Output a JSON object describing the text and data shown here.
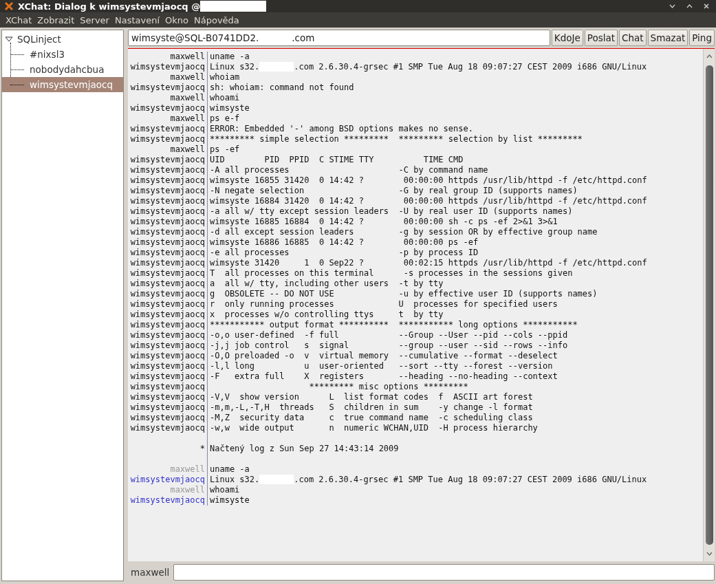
{
  "window": {
    "title": "XChat: Dialog k wimsystevmjaocq @",
    "title_redacted": true
  },
  "menu": [
    "XChat",
    "Zobrazit",
    "Server",
    "Nastavení",
    "Okno",
    "Nápověda"
  ],
  "tree": {
    "label": "SQLinject",
    "expanded": true,
    "children": [
      {
        "label": "#nixsl3",
        "selected": false
      },
      {
        "label": "nobodydahcbua",
        "selected": false
      },
      {
        "label": "wimsystevmjaocq",
        "selected": true
      }
    ]
  },
  "topic_parts": [
    "wimsyste@SQL-B0741DD2.",
    ".com"
  ],
  "buttons": [
    "KdoJe",
    "Poslat",
    "Chat",
    "Smazat",
    "Ping"
  ],
  "log": [
    {
      "kind": "old",
      "nick": "maxwell",
      "text": [
        "uname -a"
      ]
    },
    {
      "kind": "old",
      "nick": "wimsystevmjaocq",
      "text": [
        "Linux s32.",
        ".com 2.6.30.4-grsec #1 SMP Tue Aug 18 09:07:27 CEST 2009 i686 GNU/Linux"
      ]
    },
    {
      "kind": "old",
      "nick": "maxwell",
      "text": [
        "whoiam"
      ]
    },
    {
      "kind": "old",
      "nick": "wimsystevmjaocq",
      "text": [
        "sh: whoiam: command not found"
      ]
    },
    {
      "kind": "old",
      "nick": "maxwell",
      "text": [
        "whoami"
      ]
    },
    {
      "kind": "old",
      "nick": "wimsystevmjaocq",
      "text": [
        "wimsyste"
      ]
    },
    {
      "kind": "old",
      "nick": "maxwell",
      "text": [
        "ps e-f"
      ]
    },
    {
      "kind": "old",
      "nick": "wimsystevmjaocq",
      "text": [
        "ERROR: Embedded '-' among BSD options makes no sense."
      ]
    },
    {
      "kind": "old",
      "nick": "wimsystevmjaocq",
      "text": [
        "********* simple selection *********  ********* selection by list *********"
      ]
    },
    {
      "kind": "old",
      "nick": "maxwell",
      "text": [
        "ps -ef"
      ]
    },
    {
      "kind": "old",
      "nick": "wimsystevmjaocq",
      "text": [
        "UID        PID  PPID  C STIME TTY          TIME CMD"
      ]
    },
    {
      "kind": "old",
      "nick": "wimsystevmjaocq",
      "text": [
        "-A all processes                      -C by command name"
      ]
    },
    {
      "kind": "old",
      "nick": "wimsystevmjaocq",
      "text": [
        "wimsyste 16855 31420  0 14:42 ?        00:00:00 httpds /usr/lib/httpd -f /etc/httpd.conf"
      ]
    },
    {
      "kind": "old",
      "nick": "wimsystevmjaocq",
      "text": [
        "-N negate selection                   -G by real group ID (supports names)"
      ]
    },
    {
      "kind": "old",
      "nick": "wimsystevmjaocq",
      "text": [
        "wimsyste 16884 31420  0 14:42 ?        00:00:00 httpds /usr/lib/httpd -f /etc/httpd.conf"
      ]
    },
    {
      "kind": "old",
      "nick": "wimsystevmjaocq",
      "text": [
        "-a all w/ tty except session leaders  -U by real user ID (supports names)"
      ]
    },
    {
      "kind": "old",
      "nick": "wimsystevmjaocq",
      "text": [
        "wimsyste 16885 16884  0 14:42 ?        00:00:00 sh -c ps -ef 2>&1 3>&1"
      ]
    },
    {
      "kind": "old",
      "nick": "wimsystevmjaocq",
      "text": [
        "-d all except session leaders         -g by session OR by effective group name"
      ]
    },
    {
      "kind": "old",
      "nick": "wimsystevmjaocq",
      "text": [
        "wimsyste 16886 16885  0 14:42 ?        00:00:00 ps -ef"
      ]
    },
    {
      "kind": "old",
      "nick": "wimsystevmjaocq",
      "text": [
        "-e all processes                      -p by process ID"
      ]
    },
    {
      "kind": "old",
      "nick": "wimsystevmjaocq",
      "text": [
        "wimsyste 31420     1  0 Sep22 ?        00:02:15 httpds /usr/lib/httpd -f /etc/httpd.conf"
      ]
    },
    {
      "kind": "old",
      "nick": "wimsystevmjaocq",
      "text": [
        "T  all processes on this terminal      -s processes in the sessions given"
      ]
    },
    {
      "kind": "old",
      "nick": "wimsystevmjaocq",
      "text": [
        "a  all w/ tty, including other users  -t by tty"
      ]
    },
    {
      "kind": "old",
      "nick": "wimsystevmjaocq",
      "text": [
        "g  OBSOLETE -- DO NOT USE             -u by effective user ID (supports names)"
      ]
    },
    {
      "kind": "old",
      "nick": "wimsystevmjaocq",
      "text": [
        "r  only running processes             U  processes for specified users"
      ]
    },
    {
      "kind": "old",
      "nick": "wimsystevmjaocq",
      "text": [
        "x  processes w/o controlling ttys     t  by tty"
      ]
    },
    {
      "kind": "old",
      "nick": "wimsystevmjaocq",
      "text": [
        "*********** output format **********  *********** long options ***********"
      ]
    },
    {
      "kind": "old",
      "nick": "wimsystevmjaocq",
      "text": [
        "-o,o user-defined  -f full            --Group --User --pid --cols --ppid"
      ]
    },
    {
      "kind": "old",
      "nick": "wimsystevmjaocq",
      "text": [
        "-j,j job control   s  signal          --group --user --sid --rows --info"
      ]
    },
    {
      "kind": "old",
      "nick": "wimsystevmjaocq",
      "text": [
        "-O,O preloaded -o  v  virtual memory  --cumulative --format --deselect"
      ]
    },
    {
      "kind": "old",
      "nick": "wimsystevmjaocq",
      "text": [
        "-l,l long          u  user-oriented   --sort --tty --forest --version"
      ]
    },
    {
      "kind": "old",
      "nick": "wimsystevmjaocq",
      "text": [
        "-F   extra full    X  registers       --heading --no-heading --context"
      ]
    },
    {
      "kind": "old",
      "nick": "wimsystevmjaocq",
      "text": [
        "                    ********* misc options *********"
      ]
    },
    {
      "kind": "old",
      "nick": "wimsystevmjaocq",
      "text": [
        "-V,V  show version      L  list format codes  f  ASCII art forest"
      ]
    },
    {
      "kind": "old",
      "nick": "wimsystevmjaocq",
      "text": [
        "-m,m,-L,-T,H  threads   S  children in sum    -y change -l format"
      ]
    },
    {
      "kind": "old",
      "nick": "wimsystevmjaocq",
      "text": [
        "-M,Z  security data     c  true command name  -c scheduling class"
      ]
    },
    {
      "kind": "old",
      "nick": "wimsystevmjaocq",
      "text": [
        "-w,w  wide output       n  numeric WCHAN,UID  -H process hierarchy"
      ]
    },
    {
      "kind": "blank"
    },
    {
      "kind": "marker",
      "nick": "*",
      "text": [
        "Načtený log z Sun Sep 27 14:43:14 2009"
      ]
    },
    {
      "kind": "blank"
    },
    {
      "kind": "new",
      "nick": "maxwell",
      "color": "#999999",
      "text": [
        "uname -a"
      ]
    },
    {
      "kind": "new",
      "nick": "wimsystevmjaocq",
      "color": "#3333cc",
      "text": [
        "Linux s32.",
        ".com 2.6.30.4-grsec #1 SMP Tue Aug 18 09:07:27 CEST 2009 i686 GNU/Linux"
      ]
    },
    {
      "kind": "new",
      "nick": "maxwell",
      "color": "#999999",
      "text": [
        "whoami"
      ]
    },
    {
      "kind": "new",
      "nick": "wimsystevmjaocq",
      "color": "#3333cc",
      "text": [
        "wimsyste"
      ]
    }
  ],
  "input": {
    "nick": "maxwell"
  }
}
